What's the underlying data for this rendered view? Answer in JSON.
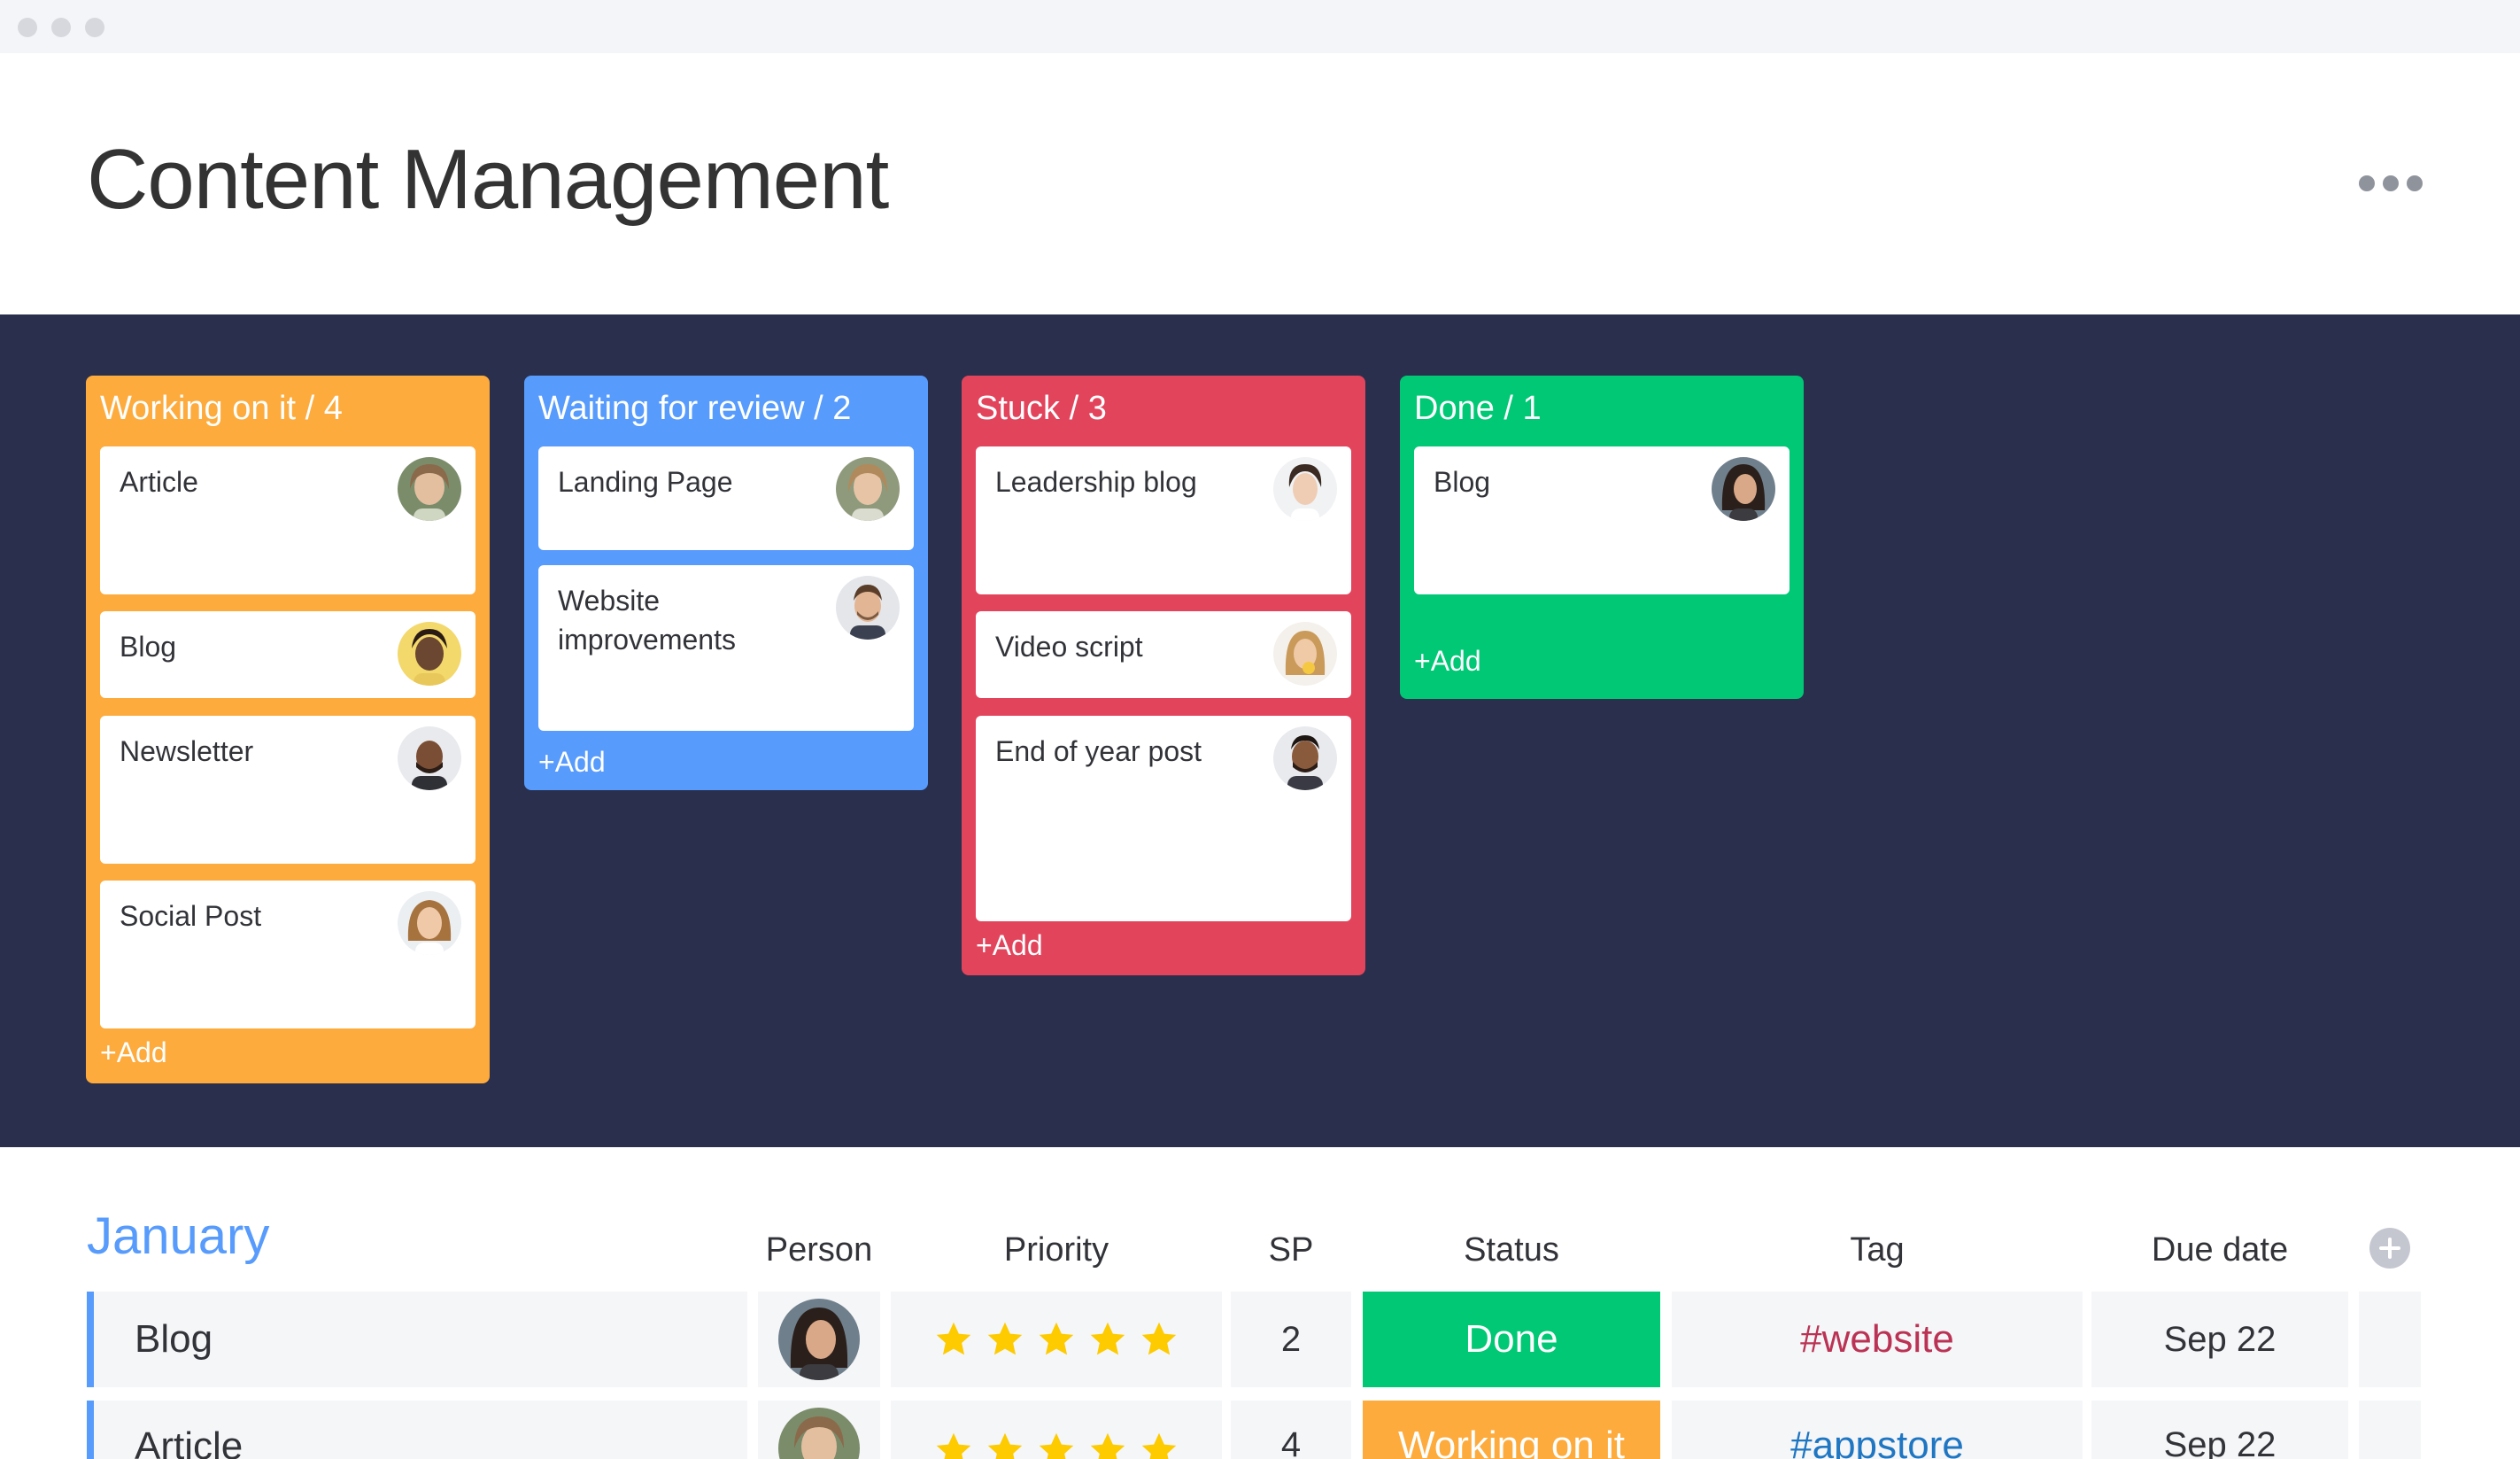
{
  "title": "Content Management",
  "colors": {
    "working": "#fdab3d",
    "review": "#579bfc",
    "stuck": "#e2445c",
    "done": "#00c875",
    "board_bg": "#292f4c",
    "tag_website": "#bb3354",
    "tag_appstore": "#1f76c2"
  },
  "kanban": {
    "columns": [
      {
        "title": "Working on it / 4",
        "add_label": "+Add",
        "cards": [
          {
            "label": "Article",
            "avatar": "avatar-icon"
          },
          {
            "label": "Blog",
            "avatar": "avatar-icon"
          },
          {
            "label": "Newsletter",
            "avatar": "avatar-icon"
          },
          {
            "label": "Social Post",
            "avatar": "avatar-icon"
          }
        ]
      },
      {
        "title": "Waiting for review / 2",
        "add_label": "+Add",
        "cards": [
          {
            "label": "Landing Page",
            "avatar": "avatar-icon"
          },
          {
            "label": "Website improvements",
            "avatar": "avatar-icon"
          }
        ]
      },
      {
        "title": "Stuck / 3",
        "add_label": "+Add",
        "cards": [
          {
            "label": "Leadership blog",
            "avatar": "avatar-icon"
          },
          {
            "label": "Video script",
            "avatar": "avatar-icon"
          },
          {
            "label": "End of year post",
            "avatar": "avatar-icon"
          }
        ]
      },
      {
        "title": "Done / 1",
        "add_label": "+Add",
        "cards": [
          {
            "label": "Blog",
            "avatar": "avatar-icon"
          }
        ]
      }
    ]
  },
  "table": {
    "group_title": "January",
    "headers": {
      "person": "Person",
      "priority": "Priority",
      "sp": "SP",
      "status": "Status",
      "tag": "Tag",
      "due": "Due date"
    },
    "rows": [
      {
        "name": "Blog",
        "priority": 5,
        "sp": "2",
        "status": "Done",
        "tag": "#website",
        "due": "Sep 22"
      },
      {
        "name": "Article",
        "priority": 5,
        "sp": "4",
        "status": "Working on it",
        "tag": "#appstore",
        "due": "Sep 22"
      }
    ]
  }
}
